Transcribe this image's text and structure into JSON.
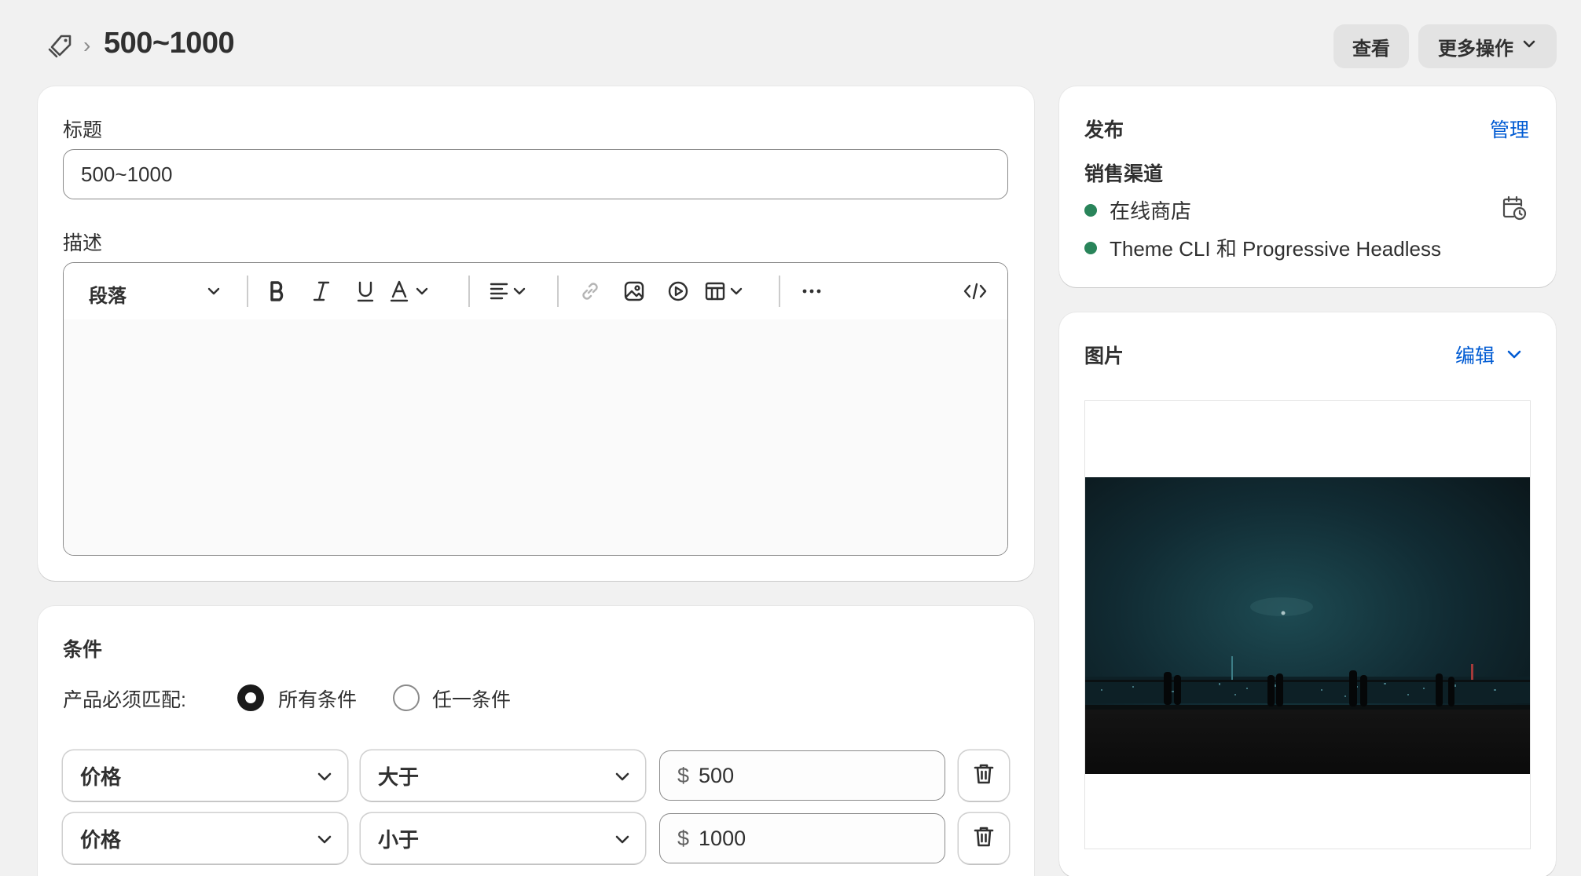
{
  "header": {
    "breadcrumb_icon": "tag-icon",
    "separator": "›",
    "title": "500~1000",
    "view_label": "查看",
    "more_label": "更多操作"
  },
  "main": {
    "title_label": "标题",
    "title_value": "500~1000",
    "description_label": "描述",
    "toolbar": {
      "paragraph_label": "段落",
      "icons": [
        "bold-icon",
        "italic-icon",
        "underline-icon",
        "text-color-icon",
        "align-icon",
        "link-icon",
        "image-icon",
        "video-icon",
        "table-icon",
        "more-icon",
        "code-icon"
      ]
    }
  },
  "conditions": {
    "title": "条件",
    "match_label": "产品必须匹配:",
    "option_all": "所有条件",
    "option_any": "任一条件",
    "selected": "all",
    "rows": [
      {
        "field": "价格",
        "operator": "大于",
        "currency": "$",
        "value": "500"
      },
      {
        "field": "价格",
        "operator": "小于",
        "currency": "$",
        "value": "1000"
      }
    ]
  },
  "publishing": {
    "title": "发布",
    "manage_label": "管理",
    "channels_label": "销售渠道",
    "channels": [
      "在线商店",
      "Theme CLI 和 Progressive Headless"
    ],
    "status_color": "#29845a"
  },
  "image": {
    "title": "图片",
    "edit_label": "编辑"
  },
  "colors": {
    "accent_link": "#005bd3",
    "background": "#f1f1f1"
  }
}
